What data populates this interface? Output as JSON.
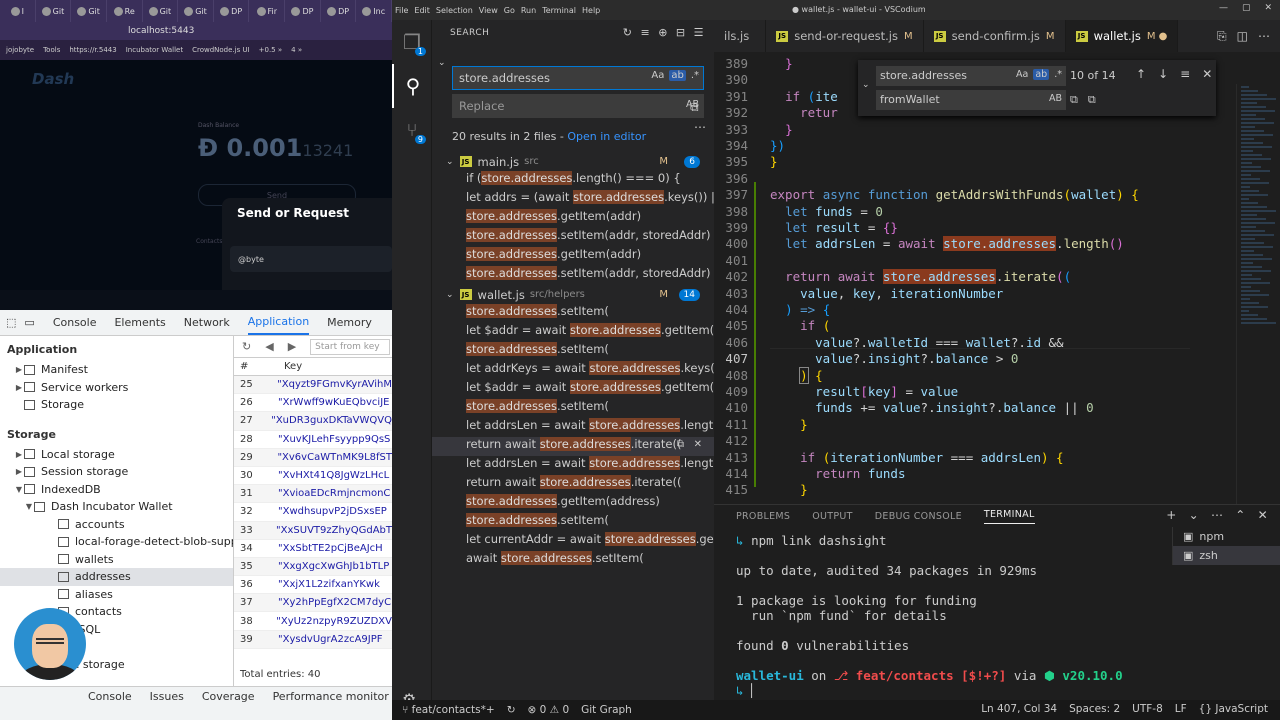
{
  "browser": {
    "tabs": [
      "I",
      "Git",
      "Git",
      "Re",
      "Git",
      "Git",
      "DP",
      "Fir",
      "DP",
      "DP",
      "Inc"
    ],
    "url": "localhost:5443",
    "bookmarks": [
      "jojobyte",
      "Tools",
      "https://r.5443",
      "Incubator Wallet",
      "CrowdNode.js UI",
      "+0.5 »",
      "4 »"
    ]
  },
  "dash_app": {
    "logo": "Dash",
    "balance_label": "Dash Balance",
    "balance_main": "0.001",
    "balance_faded": "13241",
    "send_label": "Send",
    "modal_title": "Send or Request",
    "input_value": "@byte",
    "side_label": "Contacts"
  },
  "devtools": {
    "tabs": [
      "Console",
      "Elements",
      "Network",
      "Application",
      "Memory"
    ],
    "active_tab": "Application",
    "application_header": "Application",
    "app_items": [
      "Manifest",
      "Service workers",
      "Storage"
    ],
    "storage_header": "Storage",
    "storage_items": [
      "Local storage",
      "Session storage",
      "IndexedDB",
      "Dash Incubator Wallet",
      "accounts",
      "local-forage-detect-blob-support",
      "wallets",
      "addresses",
      "aliases",
      "contacts",
      "Web SQL",
      "Cookies",
      "Private storage"
    ],
    "filter_placeholder": "Start from key",
    "columns": [
      "#",
      "Key"
    ],
    "rows": [
      {
        "n": "25",
        "k": "\"Xqyzt9FGmvKyrAVihM"
      },
      {
        "n": "26",
        "k": "\"XrWwff9wKuEQbvciJE"
      },
      {
        "n": "27",
        "k": "\"XuDR3guxDKTaVWQVQ"
      },
      {
        "n": "28",
        "k": "\"XuvKJLehFsyypp9QsS"
      },
      {
        "n": "29",
        "k": "\"Xv6vCaWTnMK9L8fST"
      },
      {
        "n": "30",
        "k": "\"XvHXt41Q8JgWzLHcL"
      },
      {
        "n": "31",
        "k": "\"XvioaEDcRmjncmonC"
      },
      {
        "n": "32",
        "k": "\"XwdhsupvP2jDSxsEP"
      },
      {
        "n": "33",
        "k": "\"XxSUVT9zZhyQGdAbT"
      },
      {
        "n": "34",
        "k": "\"XxSbtTE2pCjBeAJcH"
      },
      {
        "n": "35",
        "k": "\"XxgXgcXwGhJb1bTLP"
      },
      {
        "n": "36",
        "k": "\"XxjX1L2zifxanYKwk"
      },
      {
        "n": "37",
        "k": "\"Xy2hPpEgfX2CM7dyC"
      },
      {
        "n": "38",
        "k": "\"XyUz2nzpyR9ZUZDXV"
      },
      {
        "n": "39",
        "k": "\"XysdvUgrA2zcA9JPF"
      }
    ],
    "total": "Total entries: 40",
    "bottom_tabs": [
      "Console",
      "Issues",
      "Coverage",
      "Performance monitor",
      "Network"
    ]
  },
  "vscode": {
    "title": "● wallet.js - wallet-ui - VSCodium",
    "menu": [
      "File",
      "Edit",
      "Selection",
      "View",
      "Go",
      "Run",
      "Terminal",
      "Help"
    ],
    "search": {
      "header": "SEARCH",
      "query": "store.addresses",
      "replace_placeholder": "Replace",
      "summary": "20 results in 2 files - ",
      "open_in_editor": "Open in editor",
      "files": [
        {
          "name": "main.js",
          "path": "src",
          "status": "M",
          "count": "6",
          "matches": [
            [
              "if (",
              "store.addresses",
              ".length() === 0) {"
            ],
            [
              "let addrs = (await ",
              "store.addresses",
              ".keys()) || []"
            ],
            [
              "",
              "store.addresses",
              ".getItem(addr)"
            ],
            [
              "",
              "store.addresses",
              ".setItem(addr, storedAddr)"
            ],
            [
              "",
              "store.addresses",
              ".getItem(addr)"
            ],
            [
              "",
              "store.addresses",
              ".setItem(addr, storedAddr)"
            ]
          ]
        },
        {
          "name": "wallet.js",
          "path": "src/helpers",
          "status": "M",
          "count": "14",
          "matches": [
            [
              "",
              "store.addresses",
              ".setItem("
            ],
            [
              "let $addr = await ",
              "store.addresses",
              ".getItem(addre..."
            ],
            [
              "",
              "store.addresses",
              ".setItem("
            ],
            [
              "let addrKeys = await ",
              "store.addresses",
              ".keys()"
            ],
            [
              "let $addr = await ",
              "store.addresses",
              ".getItem(addrS..."
            ],
            [
              "",
              "store.addresses",
              ".setItem("
            ],
            [
              "let addrsLen = await ",
              "store.addresses",
              ".length()"
            ],
            [
              "return await ",
              "store.addresses",
              ".iterate(("
            ],
            [
              "let addrsLen = await ",
              "store.addresses",
              ".length()"
            ],
            [
              "return await ",
              "store.addresses",
              ".iterate(("
            ],
            [
              "",
              "store.addresses",
              ".getItem(address)"
            ],
            [
              "",
              "store.addresses",
              ".setItem("
            ],
            [
              "let currentAddr = await ",
              "store.addresses",
              ".getItem("
            ],
            [
              "await ",
              "store.addresses",
              ".setItem("
            ]
          ]
        }
      ]
    },
    "tabs": [
      {
        "name": "ils.js",
        "status": ""
      },
      {
        "name": "send-or-request.js",
        "status": "M"
      },
      {
        "name": "send-confirm.js",
        "status": "M"
      },
      {
        "name": "wallet.js",
        "status": "M ●"
      }
    ],
    "find": {
      "query": "store.addresses",
      "replace": "fromWallet",
      "count": "10 of 14"
    },
    "line_numbers": [
      "389",
      "390",
      "391",
      "392",
      "393",
      "394",
      "395",
      "396",
      "397",
      "398",
      "399",
      "400",
      "401",
      "402",
      "403",
      "404",
      "405",
      "406",
      "407",
      "408",
      "409",
      "410",
      "411",
      "412",
      "413",
      "414",
      "415"
    ],
    "panel_tabs": [
      "PROBLEMS",
      "OUTPUT",
      "DEBUG CONSOLE",
      "TERMINAL"
    ],
    "terminal": {
      "cmd": "npm link dashsight",
      "l1": "up to date, audited 34 packages in 929ms",
      "l2": "1 package is looking for funding",
      "l3": "  run `npm fund` for details",
      "l4a": "found ",
      "l4b": "0",
      "l4c": " vulnerabilities",
      "prompt_dir": "wallet-ui",
      "prompt_on": " on ",
      "prompt_branch": "feat/contacts",
      "prompt_status": "[$!+?]",
      "prompt_via": " via ",
      "prompt_node": "v20.10.0"
    },
    "terminals": [
      "npm",
      "zsh"
    ],
    "status": {
      "branch": "feat/contacts*+",
      "errors": "0",
      "warnings": "0",
      "git_graph": "Git Graph",
      "position": "Ln 407, Col 34",
      "spaces": "Spaces: 2",
      "encoding": "UTF-8",
      "eol": "LF",
      "language": "JavaScript"
    }
  }
}
